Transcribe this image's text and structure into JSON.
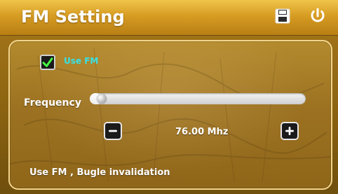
{
  "window": {
    "title": "FM Setting",
    "icons": [
      "save-icon",
      "power-icon"
    ]
  },
  "settings": {
    "use_fm_label": "Use FM",
    "use_fm_checked": true,
    "frequency_label": "Frequency",
    "frequency_value_text": "76.00 Mhz",
    "frequency_level": 0.0
  },
  "status": {
    "message": "Use FM , Bugle invalidation"
  },
  "colors": {
    "accent": "#37e2e6",
    "titlebar": "#d79c22",
    "panel": "#9c7222"
  }
}
